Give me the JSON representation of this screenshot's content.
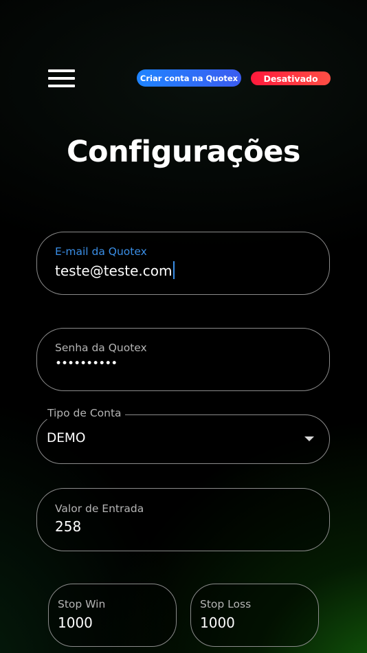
{
  "header": {
    "menu_icon": "hamburger-menu-icon",
    "create_account_label": "Criar conta na Quotex",
    "status_label": "Desativado"
  },
  "page": {
    "title": "Configurações"
  },
  "form": {
    "email": {
      "label": "E-mail da Quotex",
      "value": "teste@teste.com"
    },
    "password": {
      "label": "Senha da Quotex",
      "value": "••••••••••"
    },
    "account_type": {
      "label": "Tipo de Conta",
      "value": "DEMO",
      "icon": "dropdown-arrow-icon"
    },
    "entry_value": {
      "label": "Valor de Entrada",
      "value": "258"
    },
    "stop_win": {
      "label": "Stop Win",
      "value": "1000"
    },
    "stop_loss": {
      "label": "Stop Loss",
      "value": "1000"
    }
  },
  "colors": {
    "accent_blue": "#1f84ff",
    "status_red": "#ff1a3c",
    "focus_label": "#3a8ee6",
    "background": "#000000"
  }
}
